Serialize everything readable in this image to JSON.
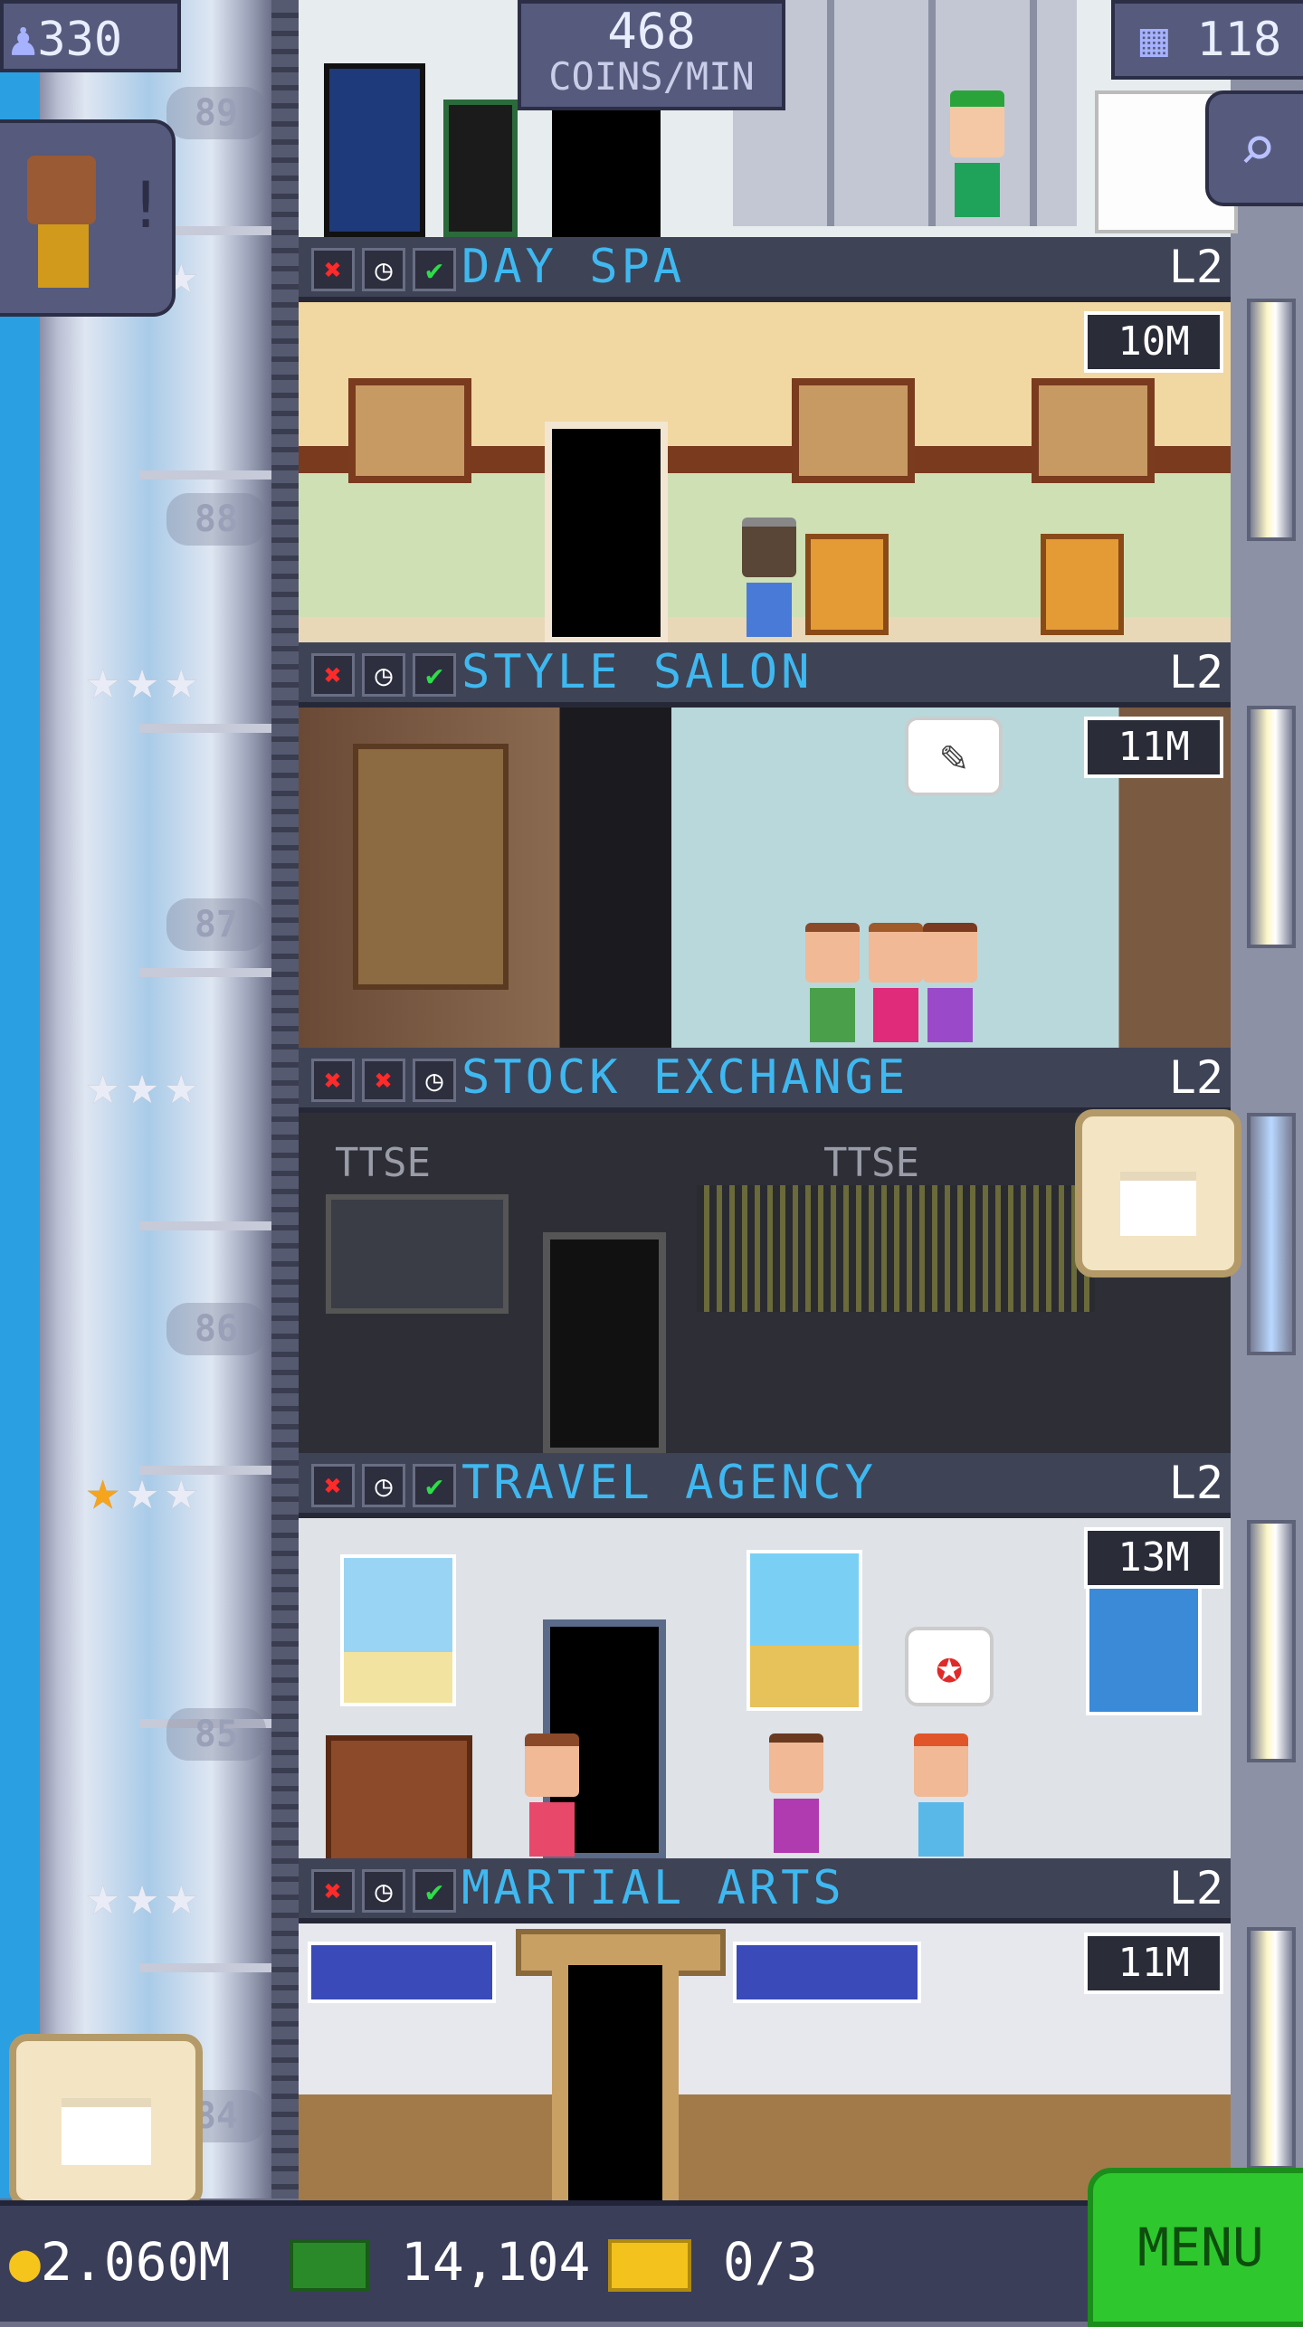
{
  "hud": {
    "population": "330",
    "coins_per_min_value": "468",
    "coins_per_min_label": "COINS/MIN",
    "floors_count": "118"
  },
  "shaft_floor_numbers": [
    "89",
    "88",
    "87",
    "86",
    "85",
    "84"
  ],
  "floors": [
    {
      "name": "DAY SPA",
      "level": "L2",
      "stock": "10M",
      "stars_gold": 0,
      "icons": [
        "x",
        "clock",
        "check"
      ]
    },
    {
      "name": "STYLE SALON",
      "level": "L2",
      "stock": "11M",
      "stars_gold": 0,
      "icons": [
        "x",
        "clock",
        "check"
      ]
    },
    {
      "name": "STOCK EXCHANGE",
      "level": "L2",
      "stock": "",
      "stars_gold": 0,
      "icons": [
        "x",
        "x",
        "clock"
      ],
      "sign_left": "TTSE",
      "sign_right": "TTSE"
    },
    {
      "name": "TRAVEL AGENCY",
      "level": "L2",
      "stock": "13M",
      "stars_gold": 1,
      "icons": [
        "x",
        "clock",
        "check"
      ]
    },
    {
      "name": "MARTIAL ARTS",
      "level": "L2",
      "stock": "11M",
      "stars_gold": 0,
      "icons": [
        "x",
        "clock",
        "check"
      ]
    }
  ],
  "bottom_bar": {
    "coins": "2.060M",
    "bux": "14,104",
    "tickets": "0/3",
    "menu_label": "MENU"
  },
  "icons": {
    "population": "person-icon",
    "floors": "building-icon",
    "search": "magnifier-icon",
    "coin": "coin-icon",
    "bux": "bux-icon",
    "ticket": "ticket-icon",
    "crate": "crate-icon",
    "alert": "exclamation-icon"
  },
  "colors": {
    "floor_title": "#3fb8f0",
    "menu_green": "#2ec72e",
    "sky": "#2a9fe2"
  }
}
